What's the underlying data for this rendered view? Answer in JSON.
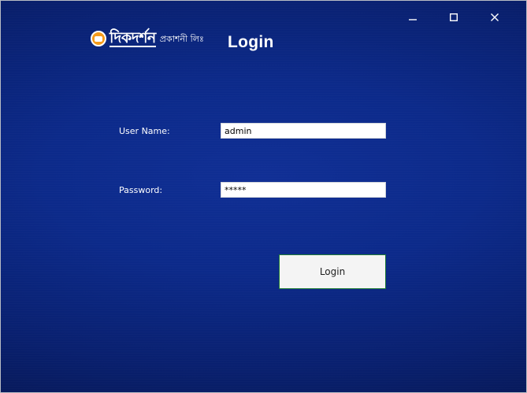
{
  "window": {
    "controls": {
      "minimize_icon": "minimize-icon",
      "maximize_icon": "maximize-icon",
      "close_icon": "close-icon"
    }
  },
  "header": {
    "logo_text": "দিকদর্শন",
    "logo_subtext": "প্রকাশনী লিঃ",
    "title": "Login"
  },
  "form": {
    "username_label": "User Name:",
    "username_value": "admin",
    "password_label": "Password:",
    "password_value": "*****",
    "login_button_label": "Login"
  },
  "colors": {
    "background_primary": "#0c2a8a",
    "background_dark": "#061651",
    "text": "#ffffff",
    "button_border": "#1e7b34"
  }
}
